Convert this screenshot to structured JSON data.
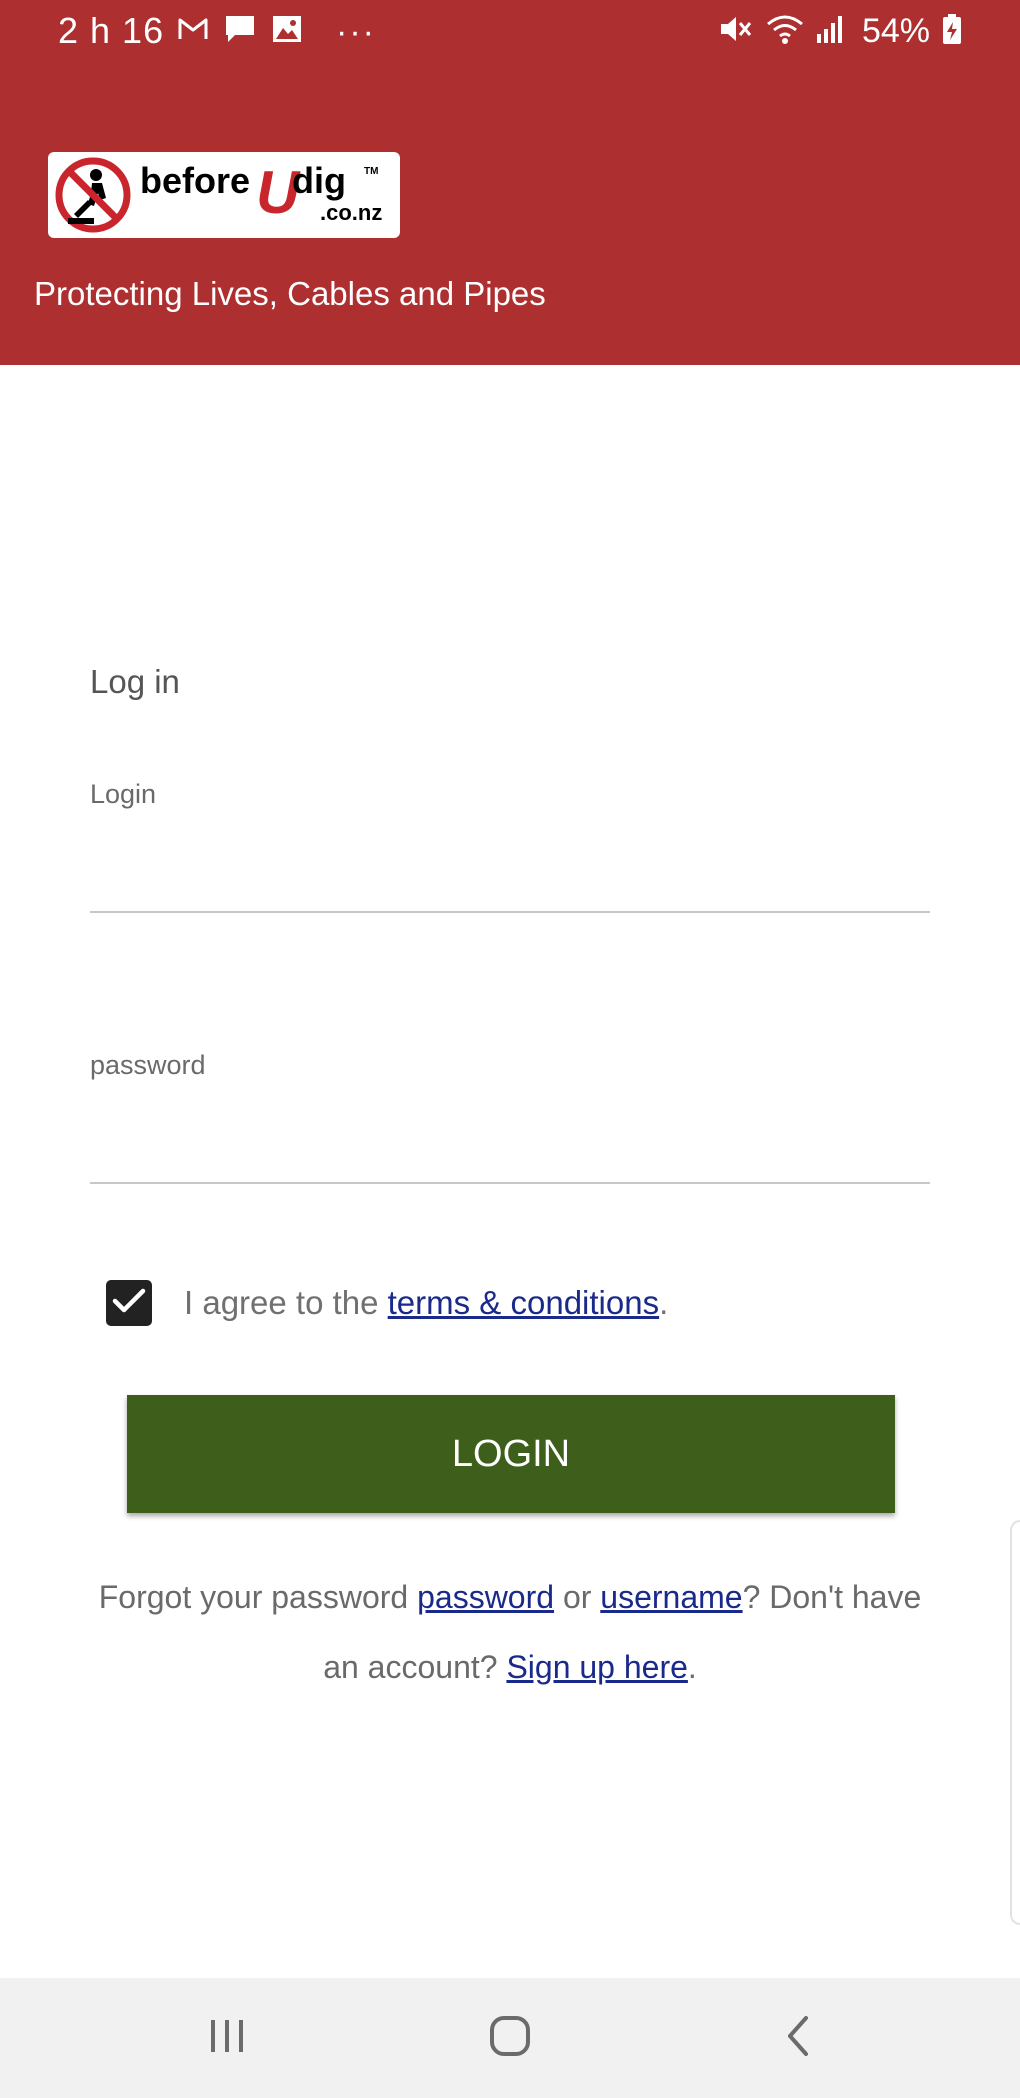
{
  "status_bar": {
    "time": "2 h 16",
    "battery": "54%",
    "more": "···"
  },
  "header": {
    "logo_before": "before",
    "logo_u": "U",
    "logo_dig": "dig",
    "logo_tm": "TM",
    "logo_domain": ".co.nz",
    "tagline": "Protecting Lives, Cables and Pipes",
    "brand_color": "#ad2f30"
  },
  "form": {
    "heading": "Log in",
    "login_label": "Login",
    "login_value": "",
    "password_label": "password",
    "password_value": "",
    "agree_checked": true,
    "agree_prefix": "I agree to the ",
    "terms_link": "terms & conditions",
    "agree_suffix": ".",
    "login_button": "LOGIN",
    "button_color": "#3e5f1b"
  },
  "help": {
    "forgot_prefix": "Forgot your password ",
    "password_link": "password",
    "or_text": " or ",
    "username_link": "username",
    "account_text": "? Don't have an account? ",
    "signup_link": "Sign up here",
    "suffix": "."
  },
  "icons": {
    "notifications": [
      "gmail-icon",
      "message-icon",
      "gallery-icon"
    ],
    "status": [
      "mute-icon",
      "wifi-icon",
      "signal-icon",
      "battery-charging-icon"
    ],
    "nav": [
      "recent-apps-icon",
      "home-icon",
      "back-icon"
    ]
  }
}
